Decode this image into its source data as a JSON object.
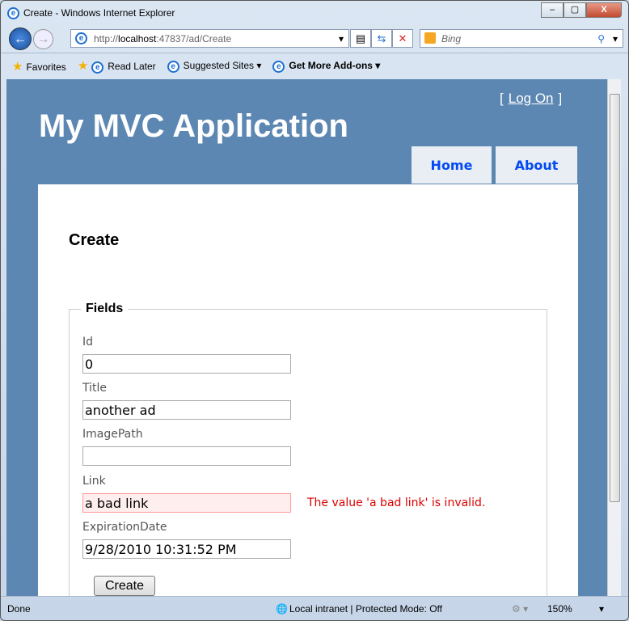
{
  "window": {
    "title": "Create - Windows Internet Explorer",
    "minimize": "–",
    "maximize": "▢",
    "close": "X"
  },
  "nav": {
    "url_prefix": "http://",
    "url_host": "localhost",
    "url_rest": ":47837/ad/Create",
    "search_placeholder": "Bing"
  },
  "favorites": {
    "favorites": "Favorites",
    "items": [
      "Read Later",
      "Suggested Sites ▾",
      "Get More Add-ons ▾"
    ]
  },
  "page": {
    "logon_open": "[",
    "logon": "Log On",
    "logon_close": "]",
    "app_title": "My MVC Application",
    "tabs": [
      "Home",
      "About"
    ],
    "heading": "Create",
    "legend": "Fields",
    "fields": [
      {
        "label": "Id",
        "value": "0"
      },
      {
        "label": "Title",
        "value": "another ad"
      },
      {
        "label": "ImagePath",
        "value": ""
      },
      {
        "label": "Link",
        "value": "a bad link",
        "error": "The value 'a bad link' is invalid."
      },
      {
        "label": "ExpirationDate",
        "value": "9/28/2010 10:31:52 PM"
      }
    ],
    "create_button": "Create"
  },
  "status": {
    "text": "Done",
    "zone": "Local intranet | Protected Mode: Off",
    "zoom": "150%"
  }
}
